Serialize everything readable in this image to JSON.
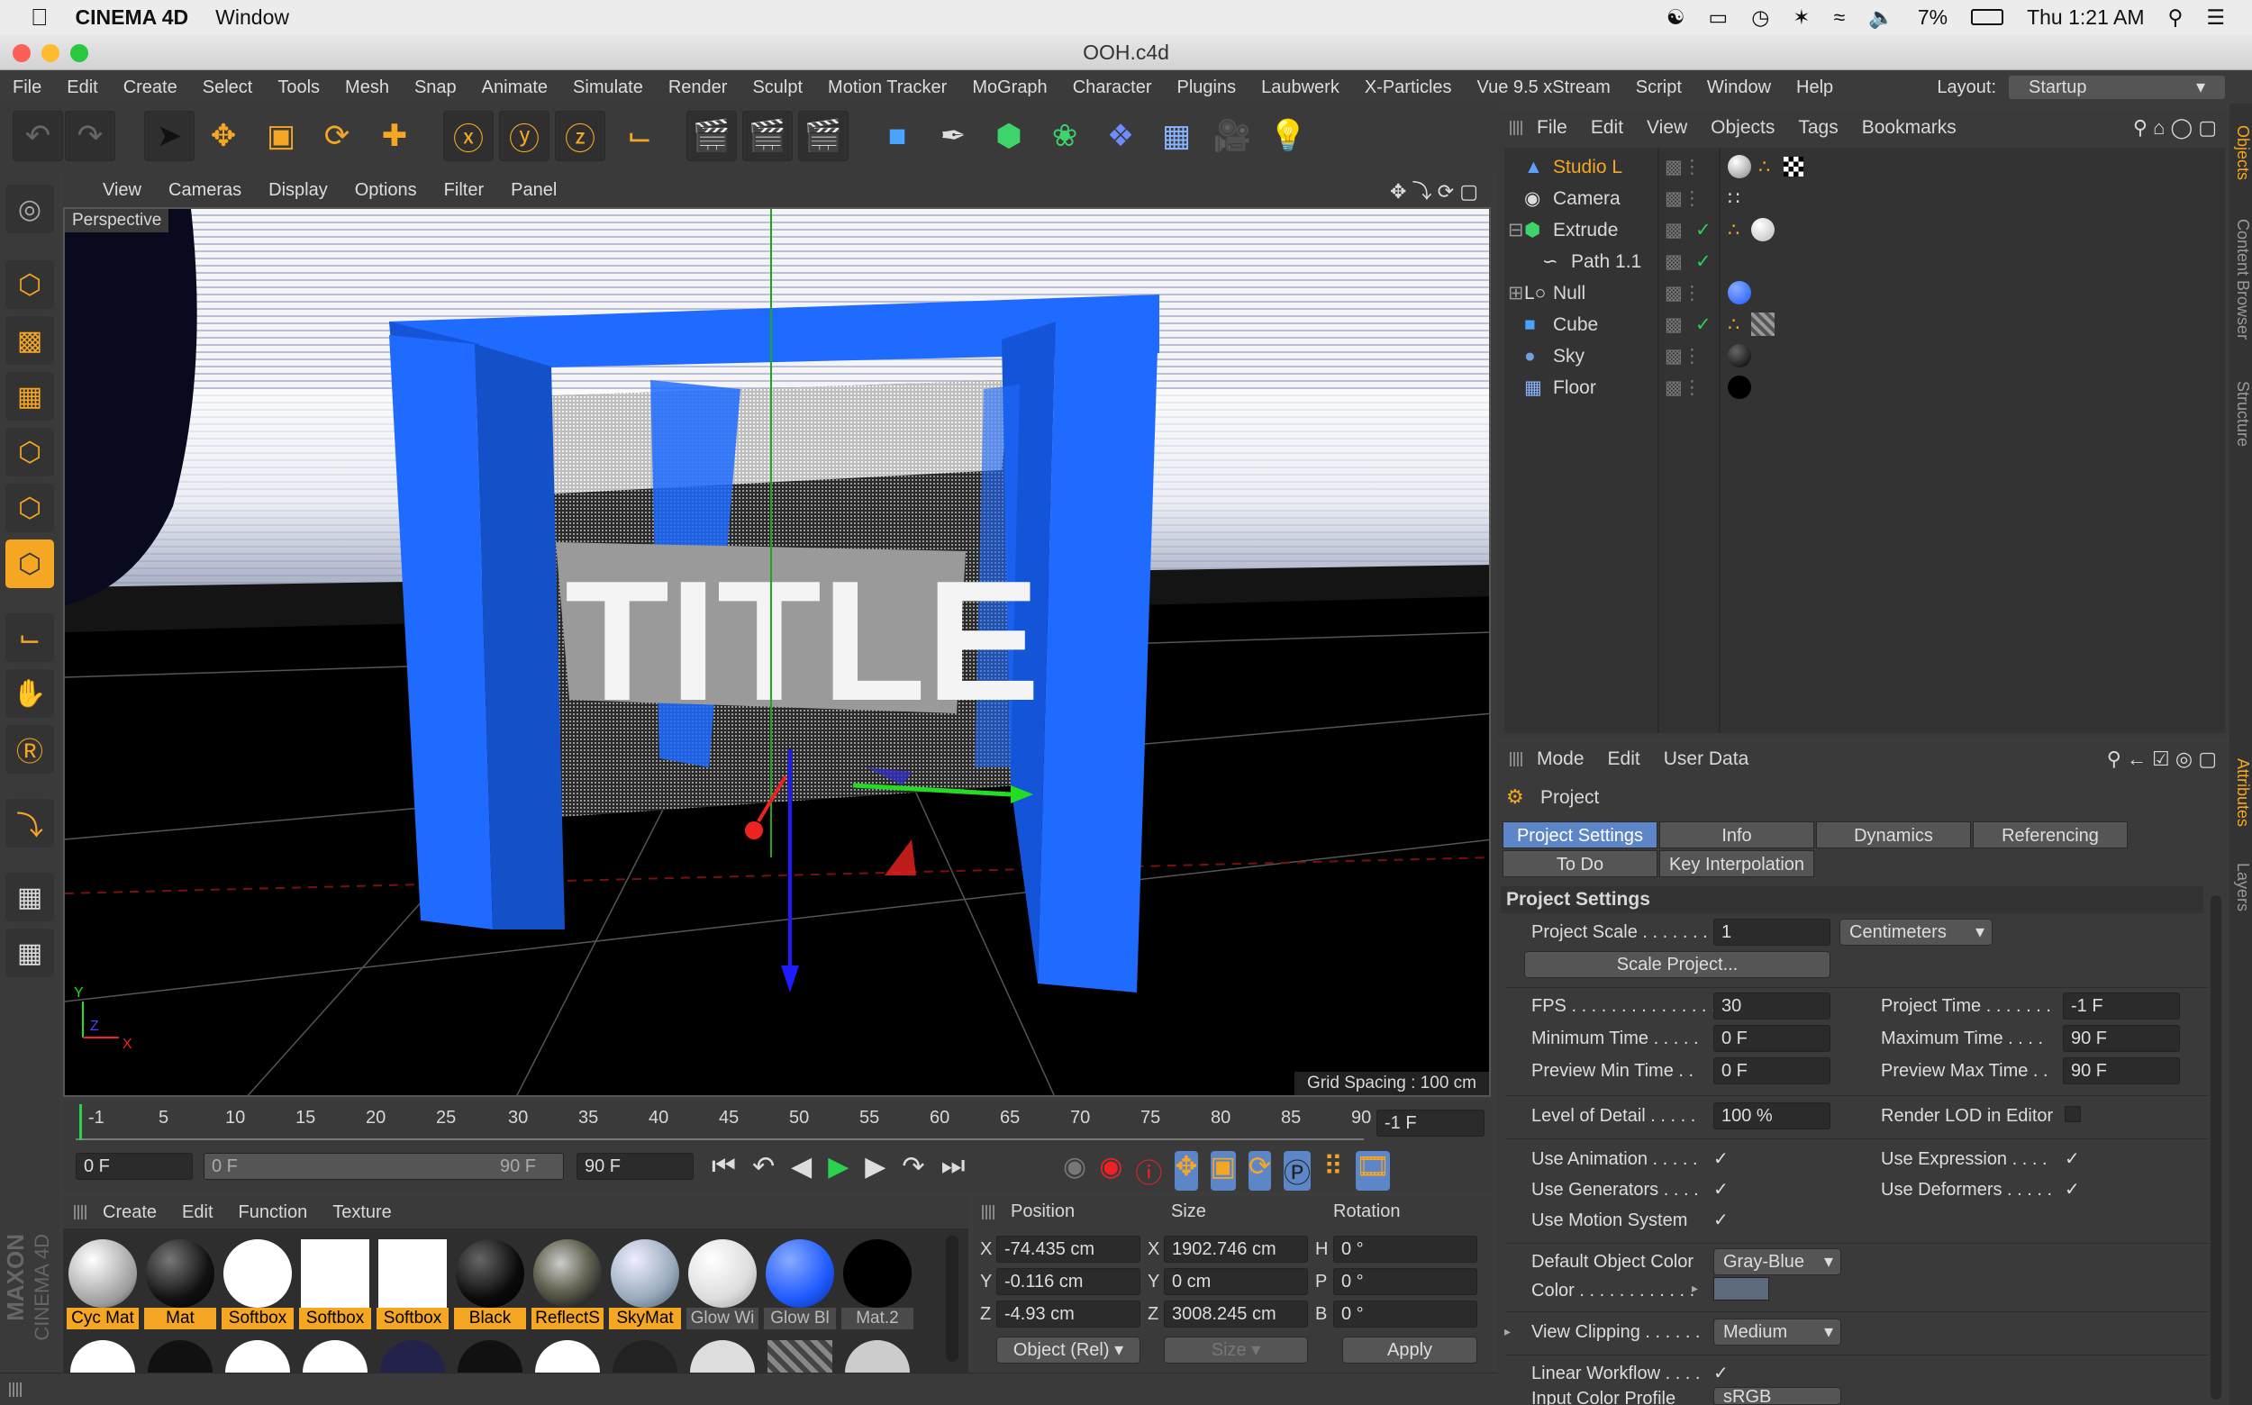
{
  "mac_menu": {
    "app": "CINEMA 4D",
    "window": "Window",
    "battery": "7%",
    "clock": "Thu 1:21 AM"
  },
  "window_title": "OOH.c4d",
  "menubar": [
    "File",
    "Edit",
    "Create",
    "Select",
    "Tools",
    "Mesh",
    "Snap",
    "Animate",
    "Simulate",
    "Render",
    "Sculpt",
    "Motion Tracker",
    "MoGraph",
    "Character",
    "Plugins",
    "Laubwerk",
    "X-Particles",
    "Vue 9.5 xStream",
    "Script",
    "Window",
    "Help"
  ],
  "layout": {
    "label": "Layout:",
    "value": "Startup"
  },
  "viewport": {
    "menu": [
      "View",
      "Cameras",
      "Display",
      "Options",
      "Filter",
      "Panel"
    ],
    "label": "Perspective",
    "grid_spacing": "Grid Spacing : 100 cm",
    "scene_text": "TITLE",
    "axis_x": "X",
    "axis_y": "Y",
    "axis_z": "Z"
  },
  "timeline": {
    "ticks": [
      "-1",
      "5",
      "10",
      "15",
      "20",
      "25",
      "30",
      "35",
      "40",
      "45",
      "50",
      "55",
      "60",
      "65",
      "70",
      "75",
      "80",
      "85",
      "90"
    ],
    "current": "-1 F"
  },
  "transport": {
    "start": "0 F",
    "slider_left": "0 F",
    "slider_right": "90 F",
    "end": "90 F"
  },
  "material_menu": [
    "Create",
    "Edit",
    "Function",
    "Texture"
  ],
  "materials": [
    {
      "name": "Cyc Mat",
      "highlight": true
    },
    {
      "name": "Mat",
      "highlight": true
    },
    {
      "name": "Softbox",
      "highlight": true
    },
    {
      "name": "Softbox",
      "highlight": true
    },
    {
      "name": "Softbox",
      "highlight": true
    },
    {
      "name": "Black",
      "highlight": true
    },
    {
      "name": "ReflectS",
      "highlight": true
    },
    {
      "name": "SkyMat",
      "highlight": true
    },
    {
      "name": "Glow Wi",
      "highlight": false
    },
    {
      "name": "Glow Bl",
      "highlight": false
    },
    {
      "name": "Mat.2",
      "highlight": false
    }
  ],
  "coordinates": {
    "headers": [
      "Position",
      "Size",
      "Rotation"
    ],
    "rows": [
      {
        "axis": "X",
        "pos": "-74.435 cm",
        "size_axis": "X",
        "size": "1902.746 cm",
        "rot_axis": "H",
        "rot": "0 °"
      },
      {
        "axis": "Y",
        "pos": "-0.116 cm",
        "size_axis": "Y",
        "size": "0 cm",
        "rot_axis": "P",
        "rot": "0 °"
      },
      {
        "axis": "Z",
        "pos": "-4.93 cm",
        "size_axis": "Z",
        "size": "3008.245 cm",
        "rot_axis": "B",
        "rot": "0 °"
      }
    ],
    "mode": "Object (Rel)",
    "size_mode": "Size",
    "apply": "Apply"
  },
  "objects": {
    "menu": [
      "File",
      "Edit",
      "View",
      "Objects",
      "Tags",
      "Bookmarks"
    ],
    "items": [
      {
        "name": "Studio L",
        "indent": 0,
        "selected": true
      },
      {
        "name": "Camera",
        "indent": 0,
        "selected": false
      },
      {
        "name": "Extrude",
        "indent": 0,
        "selected": false
      },
      {
        "name": "Path 1.1",
        "indent": 1,
        "selected": false
      },
      {
        "name": "Null",
        "indent": 0,
        "selected": false
      },
      {
        "name": "Cube",
        "indent": 0,
        "selected": false
      },
      {
        "name": "Sky",
        "indent": 0,
        "selected": false
      },
      {
        "name": "Floor",
        "indent": 0,
        "selected": false
      }
    ]
  },
  "attributes": {
    "menu": [
      "Mode",
      "Edit",
      "User Data"
    ],
    "title": "Project",
    "tabs": [
      "Project Settings",
      "Info",
      "Dynamics",
      "Referencing",
      "To Do",
      "Key Interpolation"
    ],
    "section": "Project Settings",
    "project_scale_label": "Project Scale . . . . . . .",
    "project_scale": "1",
    "units": "Centimeters",
    "scale_button": "Scale Project...",
    "fps_label": "FPS . . . . . . . . . . . . . . . . .",
    "fps": "30",
    "project_time_label": "Project Time . . . . . . .",
    "project_time": "-1 F",
    "min_time_label": "Minimum Time . . . . .",
    "min_time": "0 F",
    "max_time_label": "Maximum Time . . . .",
    "max_time": "90 F",
    "prev_min_label": "Preview Min Time . .",
    "prev_min": "0 F",
    "prev_max_label": "Preview Max Time . .",
    "prev_max": "90 F",
    "lod_label": "Level of Detail . . . . .",
    "lod": "100 %",
    "render_lod_label": "Render LOD in Editor",
    "use_anim_label": "Use Animation . . . . .",
    "use_expr_label": "Use Expression . . . .",
    "use_gen_label": "Use Generators . . . .",
    "use_def_label": "Use Deformers . . . . .",
    "use_motion_label": "Use Motion System",
    "default_color_label": "Default Object Color",
    "default_color": "Gray-Blue",
    "color_label": "Color . . . . . . . . . . . .",
    "view_clipping_label": "View Clipping . . . . . .",
    "view_clipping": "Medium",
    "linear_label": "Linear Workflow . . . .",
    "input_color_label": "Input Color Profile",
    "input_color": "sRGB"
  },
  "side_tabs": {
    "right_top": [
      "Objects",
      "Content Browser",
      "Structure"
    ],
    "right_bottom": [
      "Attributes",
      "Layers"
    ]
  },
  "brand": {
    "line1": "MAXON",
    "line2": "CINEMA 4D"
  },
  "colors": {
    "accent": "#f5a623",
    "select": "#5d86c8",
    "frame": "#1f6bff"
  }
}
